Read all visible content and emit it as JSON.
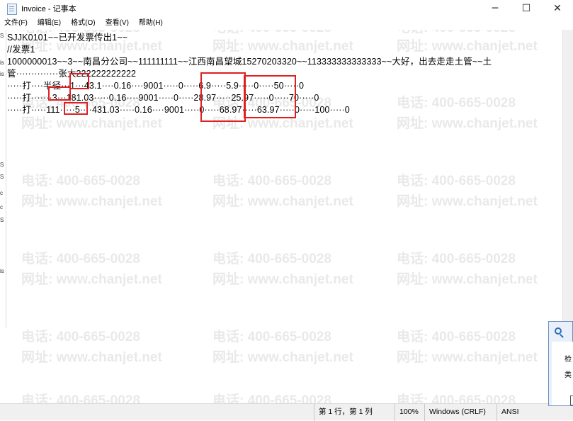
{
  "window": {
    "title": "Invoice - 记事本",
    "minimize_glyph": "─",
    "maximize_glyph": "☐",
    "close_glyph": "✕"
  },
  "menu": [
    {
      "label": "文件(F)"
    },
    {
      "label": "编辑(E)"
    },
    {
      "label": "格式(O)"
    },
    {
      "label": "查看(V)"
    },
    {
      "label": "帮助(H)"
    }
  ],
  "document": {
    "lines": [
      "SJJK0101~~已开发票传出1~~",
      "//发票1",
      "1000000013~~3~~南昌分公司~~111111111~~江西南昌望城15270203320~~113333333333333~~大好，出去走走土管~~土",
      "管··············张大222222222222",
      "·····打····半径···1···43.1····0.16····9001·····0·····6.9·····5.9·····0·····50·····0",
      "·····打·······3···181.03·····0.16····9001·····0·····28.97·····25.97·····0·····70·····0",
      "·····打·····111·····5····431.03·····0.16····9001·····0·····68.97·····63.97·····0·····100·····0"
    ]
  },
  "watermark": {
    "phone": "电话: 400-665-0028",
    "site": "网址: www.chanjet.net"
  },
  "left_strip": [
    "S",
    "is",
    "is",
    "S",
    "S",
    "c",
    "c",
    "S",
    "is"
  ],
  "status": {
    "position": "第 1 行，第 1 列",
    "zoom": "100%",
    "line_ending": "Windows (CRLF)",
    "encoding": "ANSI"
  },
  "popup": {
    "icon": "search-icon",
    "text_1": "检",
    "text_2": "类"
  },
  "colors": {
    "highlight": "#e02020",
    "watermark": "#d8d8d8"
  }
}
